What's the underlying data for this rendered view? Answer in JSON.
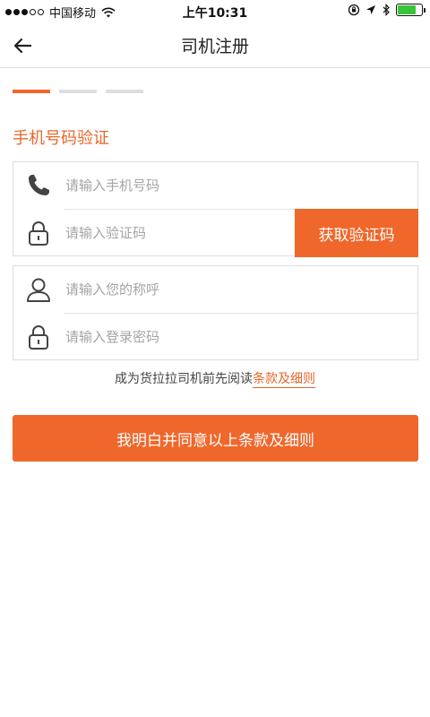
{
  "status_bar": {
    "carrier": "中国移动",
    "time": "上午10:31",
    "icons": [
      "signal-dots-icon",
      "wifi-icon",
      "lock-rotation-icon",
      "location-icon",
      "bluetooth-icon",
      "battery-icon"
    ],
    "battery_level": 0.75
  },
  "nav": {
    "title": "司机注册",
    "back_icon": "back-arrow-icon"
  },
  "steps": {
    "total": 3,
    "current": 1
  },
  "section": {
    "title": "手机号码验证"
  },
  "form": {
    "phone_placeholder": "请输入手机号码",
    "code_placeholder": "请输入验证码",
    "get_code_label": "获取验证码",
    "nickname_placeholder": "请输入您的称呼",
    "password_placeholder": "请输入登录密码"
  },
  "terms": {
    "prefix": "成为货拉拉司机前先阅读",
    "link": "条款及细则"
  },
  "agree_button": {
    "label": "我明白并同意以上条款及细则"
  },
  "colors": {
    "accent": "#f0672b",
    "accent_text": "#e8672b",
    "border": "#dddddd",
    "placeholder": "#a4a4a4"
  }
}
